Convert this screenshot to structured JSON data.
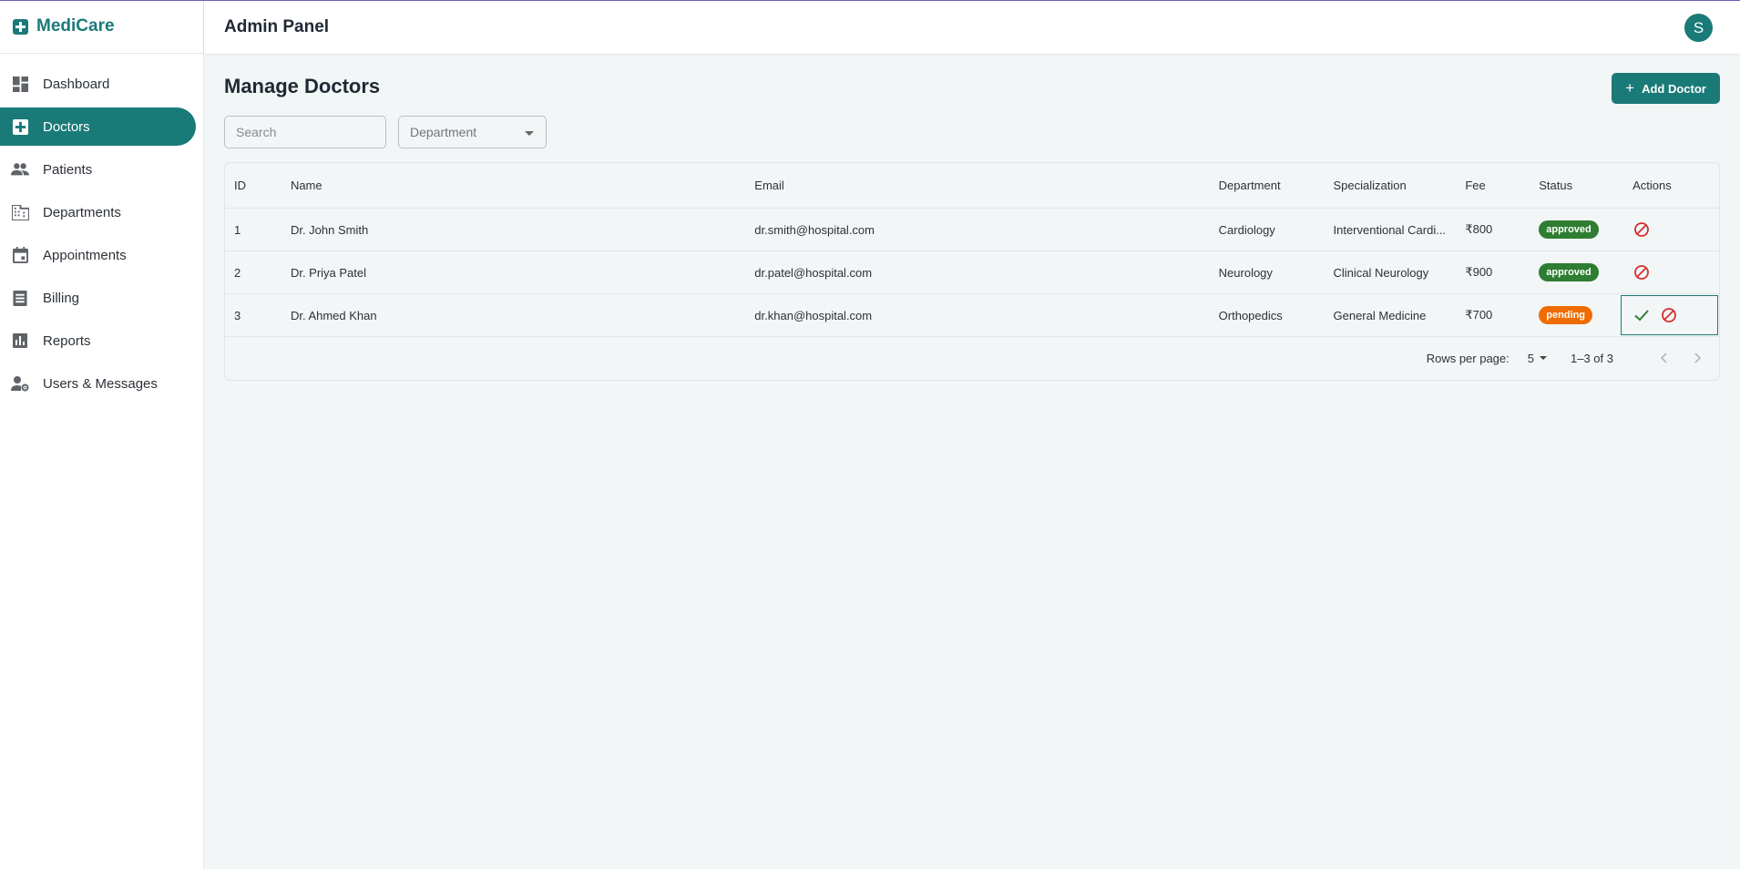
{
  "app": {
    "brand": "MediCare",
    "header_title": "Admin Panel",
    "avatar_initial": "S"
  },
  "colors": {
    "primary": "#1a7a78",
    "approved": "#2e7d32",
    "pending": "#ef6c00",
    "danger": "#d32f2f",
    "success": "#2e7d32"
  },
  "sidebar": {
    "items": [
      {
        "label": "Dashboard",
        "icon": "dashboard-icon",
        "active": false
      },
      {
        "label": "Doctors",
        "icon": "medical-plus-icon",
        "active": true
      },
      {
        "label": "Patients",
        "icon": "people-icon",
        "active": false
      },
      {
        "label": "Departments",
        "icon": "building-icon",
        "active": false
      },
      {
        "label": "Appointments",
        "icon": "calendar-icon",
        "active": false
      },
      {
        "label": "Billing",
        "icon": "receipt-icon",
        "active": false
      },
      {
        "label": "Reports",
        "icon": "bar-chart-icon",
        "active": false
      },
      {
        "label": "Users & Messages",
        "icon": "user-settings-icon",
        "active": false
      }
    ]
  },
  "main": {
    "title": "Manage Doctors",
    "add_button": "Add Doctor",
    "search_placeholder": "Search",
    "department_placeholder": "Department"
  },
  "table": {
    "columns": {
      "id": "ID",
      "name": "Name",
      "email": "Email",
      "department": "Department",
      "specialization": "Specialization",
      "fee": "Fee",
      "status": "Status",
      "actions": "Actions"
    },
    "rows": [
      {
        "id": "1",
        "name": "Dr. John Smith",
        "email": "dr.smith@hospital.com",
        "department": "Cardiology",
        "specialization": "Interventional Cardi...",
        "fee": "₹800",
        "status": "approved"
      },
      {
        "id": "2",
        "name": "Dr. Priya Patel",
        "email": "dr.patel@hospital.com",
        "department": "Neurology",
        "specialization": "Clinical Neurology",
        "fee": "₹900",
        "status": "approved"
      },
      {
        "id": "3",
        "name": "Dr. Ahmed Khan",
        "email": "dr.khan@hospital.com",
        "department": "Orthopedics",
        "specialization": "General Medicine",
        "fee": "₹700",
        "status": "pending"
      }
    ]
  },
  "pagination": {
    "rows_per_page_label": "Rows per page:",
    "rows_per_page": "5",
    "range": "1–3 of 3"
  }
}
